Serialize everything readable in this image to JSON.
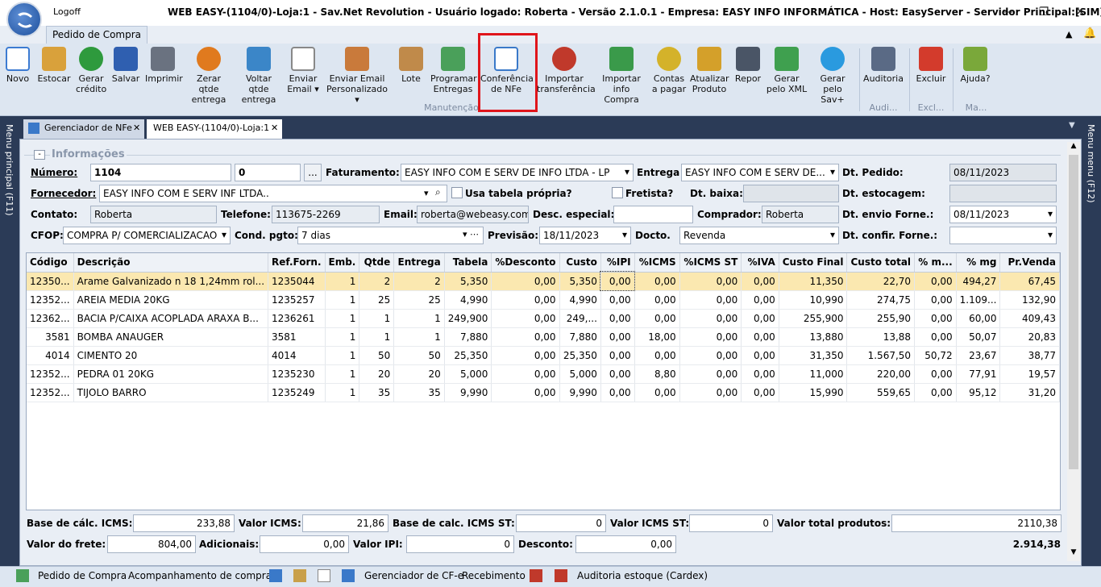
{
  "window": {
    "logoff_label": "Logoff",
    "title": "WEB EASY-(1104/0)-Loja:1 - Sav.Net Revolution - Usuário logado: Roberta - Versão 2.1.0.1 - Empresa: EASY INFO INFORMÁTICA - Host: EasyServer - Servidor Principal:[SIM]",
    "minimize": "—",
    "maximize": "❐",
    "close": "✕"
  },
  "ribbon": {
    "tab": "Pedido de Compra",
    "buttons": [
      {
        "label": "Novo",
        "color": "#3c7bd2"
      },
      {
        "label": "Estocar",
        "color": "#d9a13b"
      },
      {
        "label": "Gerar crédito",
        "color": "#2e9a3d"
      },
      {
        "label": "Salvar",
        "color": "#2f5fb0"
      },
      {
        "label": "Imprimir",
        "color": "#6a7280"
      },
      {
        "label": "Zerar qtde entrega",
        "color": "#e07a1e"
      },
      {
        "label": "Voltar qtde entrega",
        "color": "#3b86c8"
      },
      {
        "label": "Enviar Email",
        "color": "#c9c9c9"
      },
      {
        "label": "Enviar Email Personalizado",
        "color": "#c97a3b"
      },
      {
        "label": "Lote",
        "color": "#c08a4a"
      },
      {
        "label": "Programar Entregas",
        "color": "#4aa05a"
      },
      {
        "label": "Conferência de NFe",
        "color": "#3a79c9"
      },
      {
        "label": "Importar transferência",
        "color": "#c0392b"
      },
      {
        "label": "Importar info Compra",
        "color": "#3a9a4a"
      },
      {
        "label": "Contas a pagar",
        "color": "#d4b22a"
      },
      {
        "label": "Atualizar Produto",
        "color": "#d4a02a"
      },
      {
        "label": "Repor",
        "color": "#4a5566"
      },
      {
        "label": "Gerar pelo XML",
        "color": "#3fa04f"
      },
      {
        "label": "Gerar pelo Sav+",
        "color": "#2a9adf"
      },
      {
        "label": "Auditoria",
        "color": "#5a6a85"
      },
      {
        "label": "Excluir",
        "color": "#d33b2c"
      },
      {
        "label": "Ajuda?",
        "color": "#7aa83a"
      }
    ],
    "groups": {
      "manutencao": "Manutenção",
      "auditoria": "Audi...",
      "excluir": "Excl...",
      "ajuda": "Ma..."
    }
  },
  "side": {
    "left": "Menu principal (F11)",
    "right": "Menu menu (F12)"
  },
  "doc_tabs": [
    {
      "label": "Gerenciador de NFe",
      "close": "✕"
    },
    {
      "label": "WEB EASY-(1104/0)-Loja:1",
      "close": "✕"
    }
  ],
  "form": {
    "section": "Informações",
    "numero_label": "Número:",
    "numero": "1104",
    "numero2": "0",
    "numero_btn": "...",
    "faturamento_label": "Faturamento:",
    "faturamento": "EASY INFO COM E SERV DE INFO LTDA - LP",
    "entrega_label": "Entrega",
    "entrega": "EASY INFO COM E SERV DE...",
    "dt_pedido_label": "Dt. Pedido:",
    "dt_pedido": "08/11/2023",
    "fornecedor_label": "Fornecedor:",
    "fornecedor": "EASY INFO COM E SERV INF LTDA..",
    "usa_tabela_label": "Usa tabela própria?",
    "fretista_label": "Fretista?",
    "dt_baixa_label": "Dt. baixa:",
    "dt_estocagem_label": "Dt. estocagem:",
    "contato_label": "Contato:",
    "contato": "Roberta",
    "telefone_label": "Telefone:",
    "telefone": "113675-2269",
    "email_label": "Email:",
    "email": "roberta@webeasy.com",
    "desc_especial_label": "Desc. especial:",
    "comprador_label": "Comprador:",
    "comprador": "Roberta",
    "dt_envio_label": "Dt. envio Forne.:",
    "dt_envio": "08/11/2023",
    "cfop_label": "CFOP:",
    "cfop": "COMPRA P/ COMERCIALIZACAO",
    "cond_pgto_label": "Cond. pgto:",
    "cond_pgto": "7 dias",
    "previsao_label": "Previsão:",
    "previsao": "18/11/2023",
    "docto_label": "Docto.",
    "docto": "Revenda",
    "dt_confir_label": "Dt. confir. Forne.:"
  },
  "table": {
    "columns": [
      "Código",
      "Descrição",
      "Ref.Forn.",
      "Emb.",
      "Qtde",
      "Entrega",
      "Tabela",
      "%Desconto",
      "Custo",
      "%IPI",
      "%ICMS",
      "%ICMS ST",
      "%IVA",
      "Custo Final",
      "Custo total",
      "% m...",
      "% mg",
      "Pr.Venda"
    ],
    "rows": [
      [
        "12350...",
        "Arame Galvanizado n 18 1,24mm rol...",
        "1235044",
        "1",
        "2",
        "2",
        "5,350",
        "0,00",
        "5,350",
        "0,00",
        "0,00",
        "0,00",
        "0,00",
        "11,350",
        "22,70",
        "0,00",
        "494,27",
        "67,45"
      ],
      [
        "12352...",
        "AREIA MEDIA 20KG",
        "1235257",
        "1",
        "25",
        "25",
        "4,990",
        "0,00",
        "4,990",
        "0,00",
        "0,00",
        "0,00",
        "0,00",
        "10,990",
        "274,75",
        "0,00",
        "1.109...",
        "132,90"
      ],
      [
        "12362...",
        "BACIA P/CAIXA ACOPLADA ARAXA B...",
        "1236261",
        "1",
        "1",
        "1",
        "249,900",
        "0,00",
        "249,...",
        "0,00",
        "0,00",
        "0,00",
        "0,00",
        "255,900",
        "255,90",
        "0,00",
        "60,00",
        "409,43"
      ],
      [
        "3581",
        "BOMBA ANAUGER",
        "3581",
        "1",
        "1",
        "1",
        "7,880",
        "0,00",
        "7,880",
        "0,00",
        "18,00",
        "0,00",
        "0,00",
        "13,880",
        "13,88",
        "0,00",
        "50,07",
        "20,83"
      ],
      [
        "4014",
        "CIMENTO 20",
        "4014",
        "1",
        "50",
        "50",
        "25,350",
        "0,00",
        "25,350",
        "0,00",
        "0,00",
        "0,00",
        "0,00",
        "31,350",
        "1.567,50",
        "50,72",
        "23,67",
        "38,77"
      ],
      [
        "12352...",
        "PEDRA 01 20KG",
        "1235230",
        "1",
        "20",
        "20",
        "5,000",
        "0,00",
        "5,000",
        "0,00",
        "8,80",
        "0,00",
        "0,00",
        "11,000",
        "220,00",
        "0,00",
        "77,91",
        "19,57"
      ],
      [
        "12352...",
        "TIJOLO BARRO",
        "1235249",
        "1",
        "35",
        "35",
        "9,990",
        "0,00",
        "9,990",
        "0,00",
        "0,00",
        "0,00",
        "0,00",
        "15,990",
        "559,65",
        "0,00",
        "95,12",
        "31,20"
      ]
    ]
  },
  "totals": {
    "base_icms_label": "Base de cálc.  ICMS:",
    "base_icms": "233,88",
    "valor_icms_label": "Valor ICMS:",
    "valor_icms": "21,86",
    "base_icms_st_label": "Base de calc.  ICMS ST:",
    "base_icms_st": "0",
    "valor_icms_st_label": "Valor ICMS ST:",
    "valor_icms_st": "0",
    "valor_total_produtos_label": "Valor total produtos:",
    "valor_total_produtos": "2110,38",
    "valor_frete_label": "Valor do frete:",
    "valor_frete": "804,00",
    "adicionais_label": "Adicionais:",
    "adicionais": "0,00",
    "valor_ipi_label": "Valor IPI:",
    "valor_ipi": "0",
    "desconto_label": "Desconto:",
    "desconto": "0,00",
    "total": "2.914,38"
  },
  "statusbar": {
    "items": [
      "Pedido de Compra",
      "Acompanhamento de compra",
      "Gerenciador de CF-e",
      "Recebimento",
      "Auditoria estoque (Cardex)"
    ]
  }
}
